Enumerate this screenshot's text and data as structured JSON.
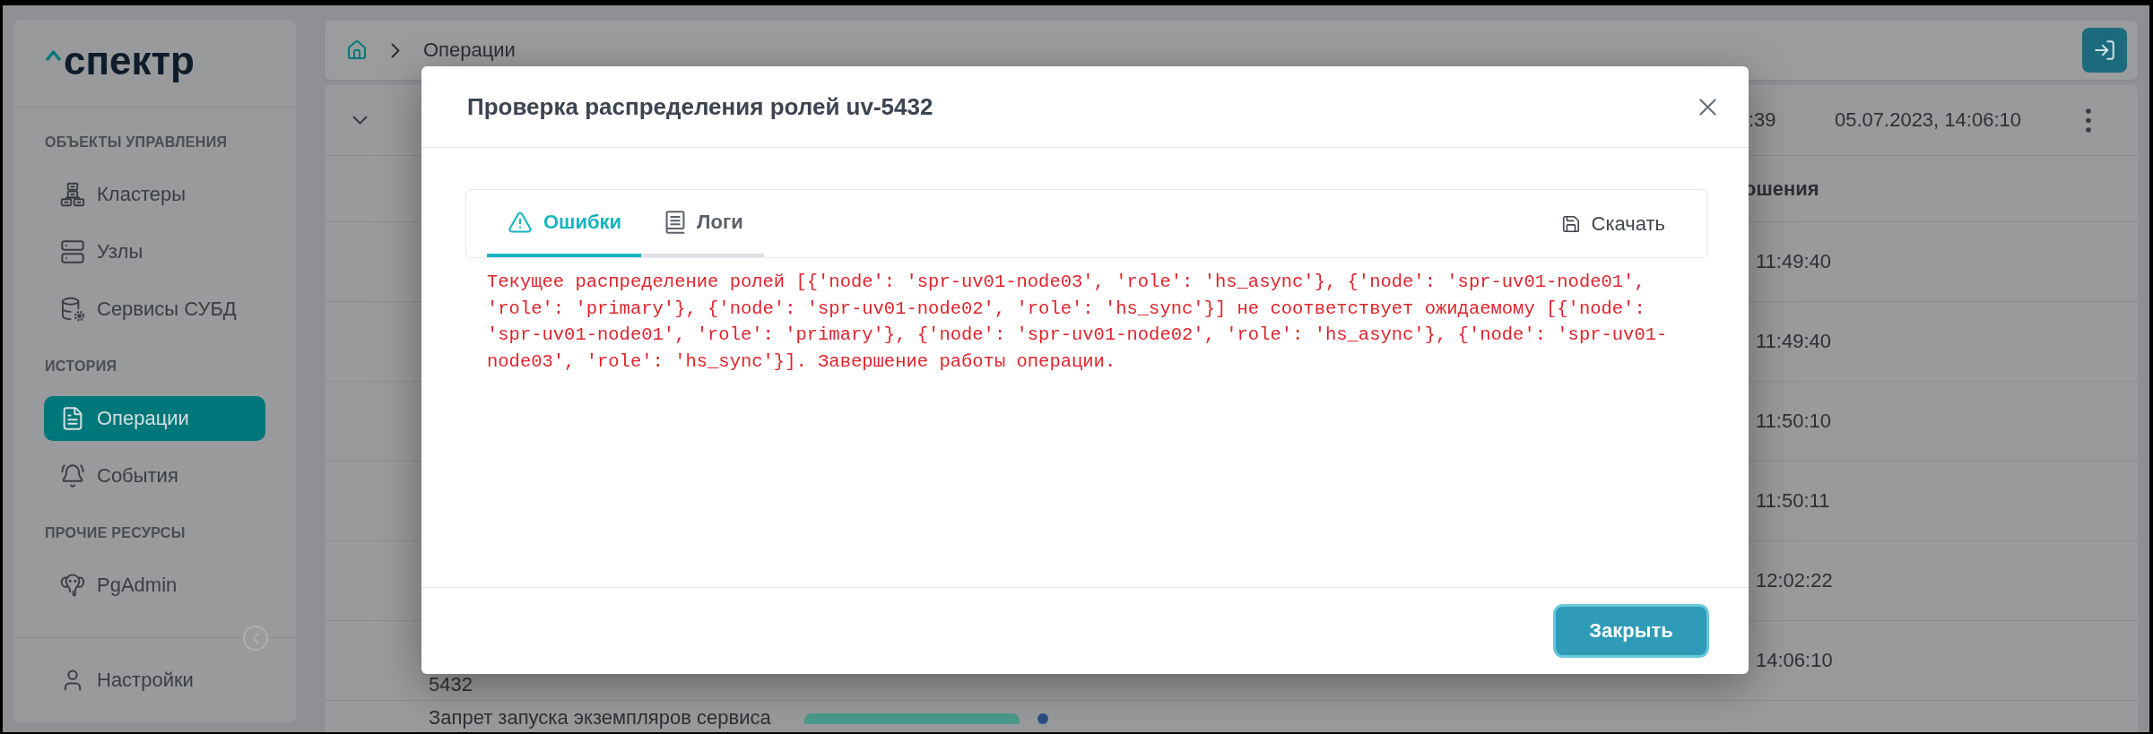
{
  "sidebar": {
    "logo": "спектр",
    "sections": [
      {
        "title": "ОБЪЕКТЫ УПРАВЛЕНИЯ",
        "items": [
          {
            "label": "Кластеры",
            "selected": false
          },
          {
            "label": "Узлы",
            "selected": false
          },
          {
            "label": "Сервисы СУБД",
            "selected": false
          }
        ]
      },
      {
        "title": "ИСТОРИЯ",
        "items": [
          {
            "label": "Операции",
            "selected": true
          },
          {
            "label": "События",
            "selected": false
          }
        ]
      },
      {
        "title": "ПРОЧИЕ РЕСУРСЫ",
        "items": [
          {
            "label": "PgAdmin",
            "selected": false
          }
        ]
      }
    ],
    "footer_item": "Настройки"
  },
  "breadcrumb": [
    "Операции"
  ],
  "table": {
    "summary_row": {
      "column_2": ":39",
      "column_3": "05.07.2023, 14:06:10"
    },
    "header": {
      "column_2": "ошения"
    },
    "rows": [
      {
        "column_2": "11:49:40"
      },
      {
        "column_2": "11:49:40"
      },
      {
        "column_2": "11:50:10"
      },
      {
        "column_2": "11:50:11"
      },
      {
        "column_2": "12:02:22"
      },
      {
        "column_1": "5432",
        "column_2": "14:06:10"
      },
      {
        "column_1": "Запрет запуска экземпляров сервиса",
        "badge": true,
        "dot": true
      }
    ]
  },
  "modal": {
    "title": "Проверка распределения ролей uv-5432",
    "tabs": [
      {
        "label": "Ошибки",
        "selected": true
      },
      {
        "label": "Логи",
        "selected": false
      }
    ],
    "download_button": "Скачать",
    "error_text": "Текущее распределение ролей [{'node': 'spr-uv01-node03', 'role': 'hs_async'}, {'node': 'spr-uv01-node01', 'role': 'primary'}, {'node': 'spr-uv01-node02', 'role': 'hs_sync'}] не соответствует ожидаемому [{'node': 'spr-uv01-node01', 'role': 'primary'}, {'node': 'spr-uv01-node02', 'role': 'hs_async'}, {'node': 'spr-uv01-node03', 'role': 'hs_sync'}]. Завершение работы операции.",
    "close_button": "Закрыть"
  }
}
